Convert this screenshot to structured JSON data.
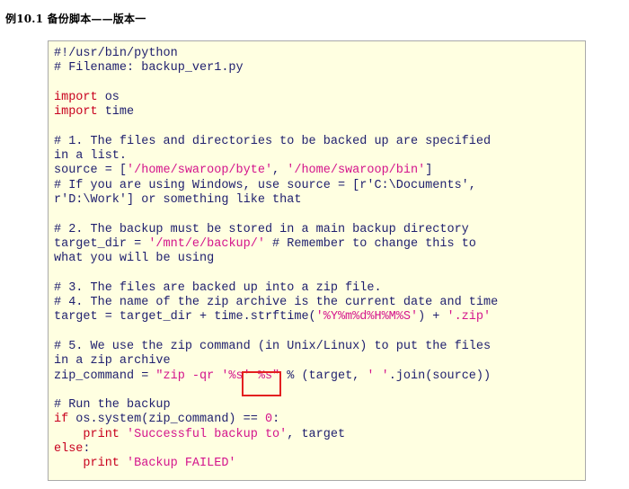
{
  "title": "例10.1 备份脚本——版本一",
  "code_lines": [
    [
      {
        "t": "#!/usr/bin/python",
        "c": "plain"
      }
    ],
    [
      {
        "t": "# Filename: backup_ver1.py",
        "c": "plain"
      }
    ],
    [],
    [
      {
        "t": "import",
        "c": "kw"
      },
      {
        "t": " os",
        "c": "plain"
      }
    ],
    [
      {
        "t": "import",
        "c": "kw"
      },
      {
        "t": " time",
        "c": "plain"
      }
    ],
    [],
    [
      {
        "t": "# 1. The files and directories to be backed up are specified",
        "c": "plain"
      }
    ],
    [
      {
        "t": "in a list.",
        "c": "plain"
      }
    ],
    [
      {
        "t": "source = [",
        "c": "plain"
      },
      {
        "t": "'/home/swaroop/byte'",
        "c": "st"
      },
      {
        "t": ", ",
        "c": "plain"
      },
      {
        "t": "'/home/swaroop/bin'",
        "c": "st"
      },
      {
        "t": "]",
        "c": "plain"
      }
    ],
    [
      {
        "t": "# If you are using Windows, use source = [r'C:\\Documents',",
        "c": "plain"
      }
    ],
    [
      {
        "t": "r'D:\\Work'] or something like that",
        "c": "plain"
      }
    ],
    [],
    [
      {
        "t": "# 2. The backup must be stored in a main backup directory",
        "c": "plain"
      }
    ],
    [
      {
        "t": "target_dir = ",
        "c": "plain"
      },
      {
        "t": "'/mnt/e/backup/'",
        "c": "st"
      },
      {
        "t": " # Remember to change this to",
        "c": "plain"
      }
    ],
    [
      {
        "t": "what you will be using",
        "c": "plain"
      }
    ],
    [],
    [
      {
        "t": "# 3. The files are backed up into a zip file.",
        "c": "plain"
      }
    ],
    [
      {
        "t": "# 4. The name of the zip archive is the current date and time",
        "c": "plain"
      }
    ],
    [
      {
        "t": "target = target_dir + time.strftime(",
        "c": "plain"
      },
      {
        "t": "'%Y%m%d%H%M%S'",
        "c": "st"
      },
      {
        "t": ") + ",
        "c": "plain"
      },
      {
        "t": "'.zip'",
        "c": "st"
      }
    ],
    [],
    [
      {
        "t": "# 5. We use the zip command (in Unix/Linux) to put the files",
        "c": "plain"
      }
    ],
    [
      {
        "t": "in a zip archive",
        "c": "plain"
      }
    ],
    [
      {
        "t": "zip_command = ",
        "c": "plain"
      },
      {
        "t": "\"zip -qr '%s' %s\"",
        "c": "st"
      },
      {
        "t": " % (target, ",
        "c": "plain"
      },
      {
        "t": "' '",
        "c": "st"
      },
      {
        "t": ".join(source))",
        "c": "plain"
      }
    ],
    [],
    [
      {
        "t": "# Run the backup",
        "c": "plain"
      }
    ],
    [
      {
        "t": "if",
        "c": "kw"
      },
      {
        "t": " os.system(zip_command) == ",
        "c": "plain"
      },
      {
        "t": "0",
        "c": "num"
      },
      {
        "t": ":",
        "c": "plain"
      }
    ],
    [
      {
        "t": "    print ",
        "c": "kw"
      },
      {
        "t": "'Successful backup to'",
        "c": "st"
      },
      {
        "t": ", target",
        "c": "plain"
      }
    ],
    [
      {
        "t": "else",
        "c": "kw"
      },
      {
        "t": ":",
        "c": "plain"
      }
    ],
    [
      {
        "t": "    print ",
        "c": "kw"
      },
      {
        "t": "'Backup FAILED'",
        "c": "st"
      }
    ]
  ],
  "colors": {
    "background": "#ffffe1",
    "border": "#a9a9a9",
    "plain": "#1e1e6e",
    "keyword": "#c8001e",
    "string": "#d4148c",
    "highlight_box": "#e32020"
  }
}
